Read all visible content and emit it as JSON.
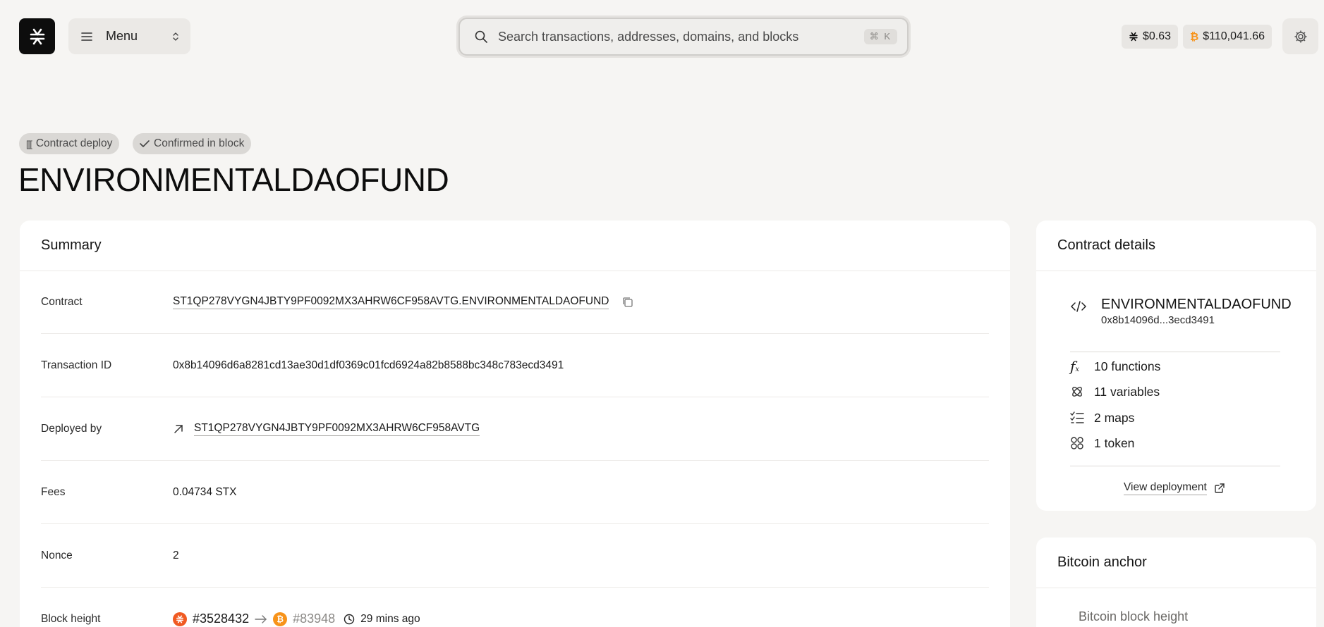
{
  "header": {
    "menu_label": "Menu",
    "search_placeholder": "Search transactions, addresses, domains, and blocks",
    "search_shortcut": "⌘ K",
    "stx_price": "$0.63",
    "btc_price": "$110,041.66"
  },
  "badges": {
    "type_label": "Contract deploy",
    "status_label": "Confirmed in block"
  },
  "page_title": "ENVIRONMENTALDAOFUND",
  "summary": {
    "title": "Summary",
    "rows": {
      "contract": {
        "label": "Contract",
        "value": "ST1QP278VYGN4JBTY9PF0092MX3AHRW6CF958AVTG.ENVIRONMENTALDAOFUND"
      },
      "txid": {
        "label": "Transaction ID",
        "value": "0x8b14096d6a8281cd13ae30d1df0369c01fcd6924a82b8588bc348c783ecd3491"
      },
      "deployer": {
        "label": "Deployed by",
        "value": "ST1QP278VYGN4JBTY9PF0092MX3AHRW6CF958AVTG"
      },
      "fees": {
        "label": "Fees",
        "value": "0.04734 STX"
      },
      "nonce": {
        "label": "Nonce",
        "value": "2"
      },
      "block": {
        "label": "Block height",
        "stacks_block": "#3528432",
        "btc_block": "#83948",
        "time_ago": "29 mins ago"
      }
    }
  },
  "contract_details": {
    "title": "Contract details",
    "name": "ENVIRONMENTALDAOFUND",
    "short_id": "0x8b14096d...3ecd3491",
    "functions": "10 functions",
    "variables": "11 variables",
    "maps": "2 maps",
    "tokens": "1 token",
    "view_deployment": "View deployment"
  },
  "bitcoin_anchor": {
    "title": "Bitcoin anchor",
    "block_height_label": "Bitcoin block height"
  },
  "colors": {
    "stx_orange": "#f05a22",
    "btc_orange": "#f7931a",
    "background": "#f6f5f3",
    "card": "#ffffff"
  }
}
